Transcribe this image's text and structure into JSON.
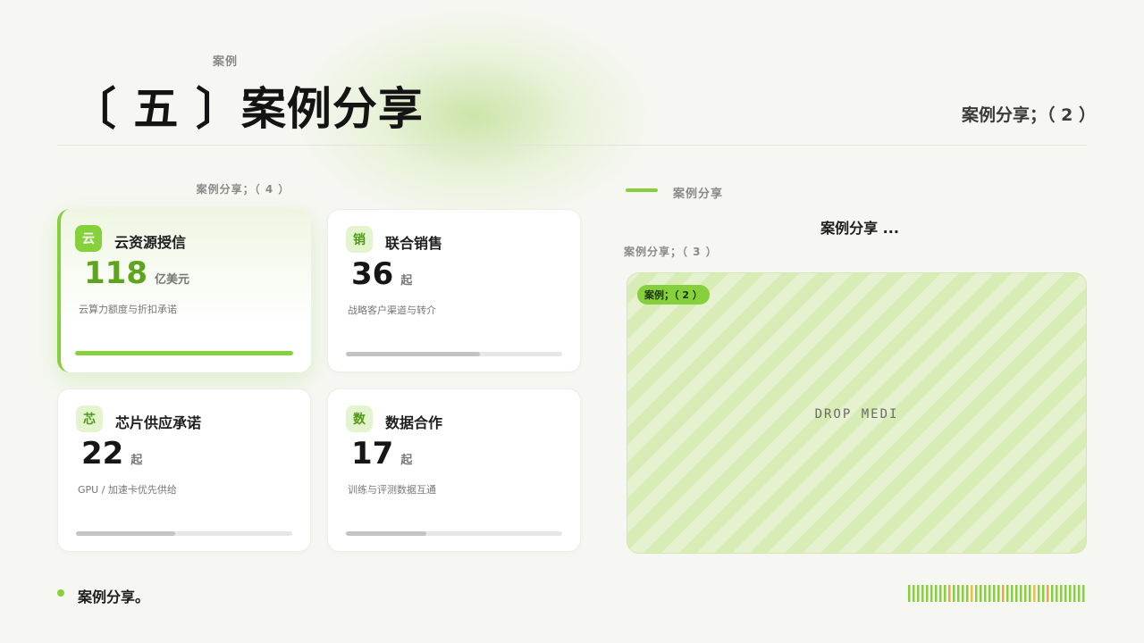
{
  "header": {
    "eyebrow": "案例",
    "title": "〔 五 〕案例分享",
    "right_label": "案例分享；（ 2 ）"
  },
  "left_panel": {
    "caption": "案例分享；（ 4 ）",
    "cards": [
      {
        "icon_char": "云",
        "title": "云资源授信",
        "value": "118",
        "unit": "亿美元",
        "desc": "云算力额度与折扣承诺",
        "progress": 1.0,
        "active": true
      },
      {
        "icon_char": "销",
        "title": "联合销售",
        "value": "36",
        "unit": "起",
        "desc": "战略客户渠道与转介",
        "progress": 0.62,
        "active": false
      },
      {
        "icon_char": "芯",
        "title": "芯片供应承诺",
        "value": "22",
        "unit": "起",
        "desc": "GPU / 加速卡优先供给",
        "progress": 0.46,
        "active": false
      },
      {
        "icon_char": "数",
        "title": "数据合作",
        "value": "17",
        "unit": "起",
        "desc": "训练与评测数据互通",
        "progress": 0.37,
        "active": false
      }
    ]
  },
  "right_panel": {
    "section_label": "案例分享",
    "heading": "案例分享 ...",
    "caption": "案例分享；（ 3 ）",
    "drop_zone": {
      "badge": "案例；（ 2 ）",
      "placeholder": "DROP MEDI"
    }
  },
  "footer": {
    "text": "案例分享。"
  },
  "colors": {
    "accent": "#86d13b",
    "accent_dark": "#5ea41f",
    "barcode": [
      "#86d13b",
      "#f0a24a",
      "#e8c04a"
    ]
  }
}
